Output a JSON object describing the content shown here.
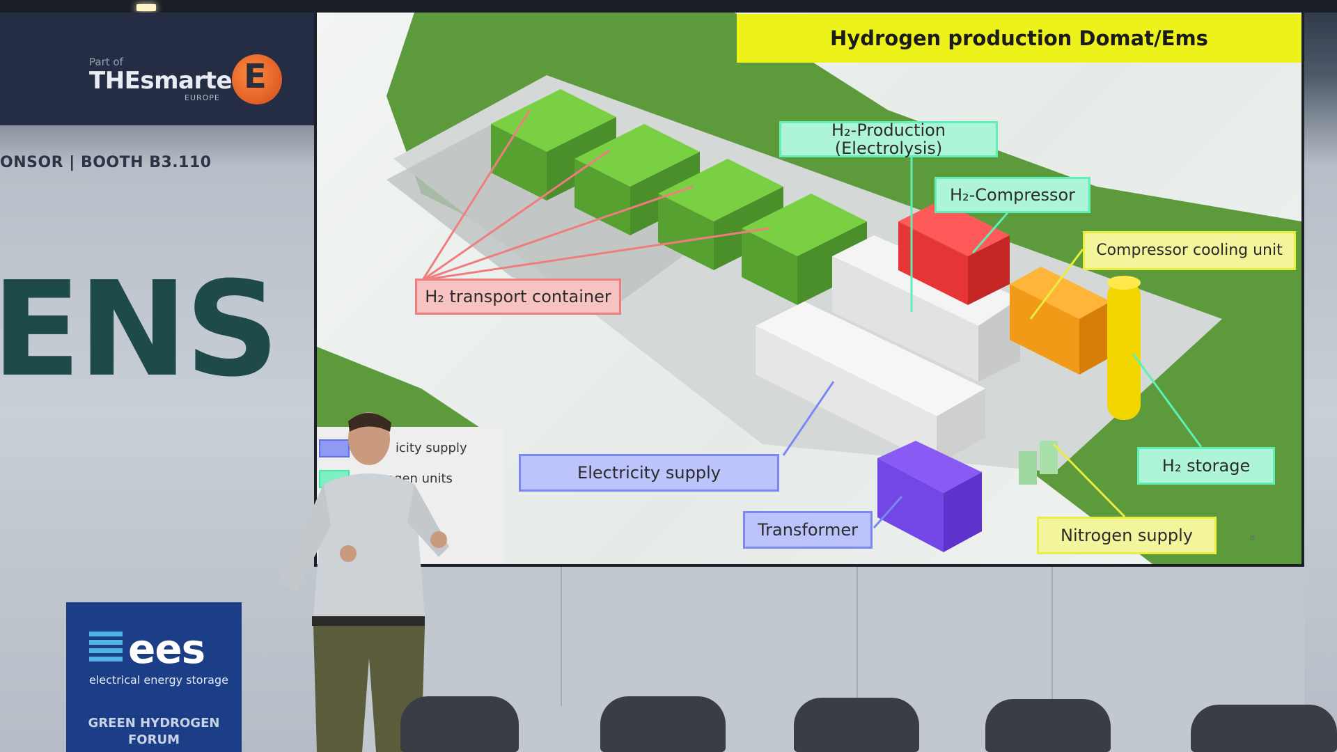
{
  "venue": {
    "smarter_logo": {
      "part_of": "Part of",
      "name": "THEsmarter",
      "region": "EUROPE",
      "badge_icon": "smarter-e-icon",
      "badge_glyph": "E"
    },
    "sponsor_text": "ONSOR | BOOTH B3.110",
    "siemens_fragment": "ENS",
    "ees": {
      "logo": "ees",
      "subtitle": "electrical energy storage",
      "forum_line1": "GREEN HYDROGEN",
      "forum_line2": "FORUM"
    }
  },
  "slide": {
    "title": "Hydrogen production Domat/Ems",
    "labels": {
      "electrolysis": "H₂-Production (Electrolysis)",
      "compressor": "H₂-Compressor",
      "cooling": "Compressor cooling unit",
      "transport": "H₂ transport container",
      "electricity": "Electricity supply",
      "transformer": "Transformer",
      "h2_storage": "H₂ storage",
      "nitrogen": "Nitrogen supply"
    },
    "legend": {
      "item1": "icity supply",
      "item2": "rogen units"
    },
    "page_number": "8"
  },
  "colors": {
    "title_bar": "#eef21b",
    "green_label": "#5ef0b4",
    "red_label": "#f07d7d",
    "blue_label": "#7a87f4",
    "yellow_label": "#e9ef3e",
    "ees_blue": "#1c3e86"
  }
}
